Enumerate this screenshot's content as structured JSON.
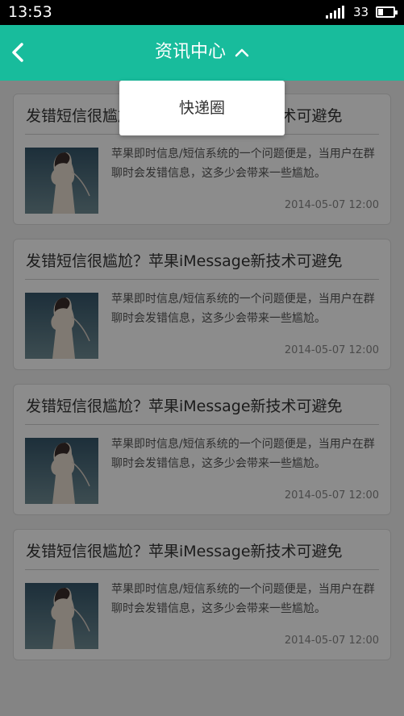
{
  "status_bar": {
    "time": "13:53",
    "battery": "33",
    "battery_level": 0.33
  },
  "header": {
    "title": "资讯中心"
  },
  "dropdown": {
    "items": [
      "快递圈"
    ]
  },
  "articles": [
    {
      "title": "发错短信很尴尬？苹果iMessage新技术可避免",
      "summary": "苹果即时信息/短信系统的一个问题便是，当用户在群聊时会发错信息，这多少会带来一些尴尬。",
      "date": "2014-05-07  12:00"
    },
    {
      "title": "发错短信很尴尬？苹果iMessage新技术可避免",
      "summary": "苹果即时信息/短信系统的一个问题便是，当用户在群聊时会发错信息，这多少会带来一些尴尬。",
      "date": "2014-05-07  12:00"
    },
    {
      "title": "发错短信很尴尬？苹果iMessage新技术可避免",
      "summary": "苹果即时信息/短信系统的一个问题便是，当用户在群聊时会发错信息，这多少会带来一些尴尬。",
      "date": "2014-05-07  12:00"
    },
    {
      "title": "发错短信很尴尬？苹果iMessage新技术可避免",
      "summary": "苹果即时信息/短信系统的一个问题便是，当用户在群聊时会发错信息，这多少会带来一些尴尬。",
      "date": "2014-05-07  12:00"
    }
  ],
  "colors": {
    "header": "#18bc9c",
    "status_bar": "#000000",
    "overlay": "rgba(0,0,0,0.45)"
  }
}
